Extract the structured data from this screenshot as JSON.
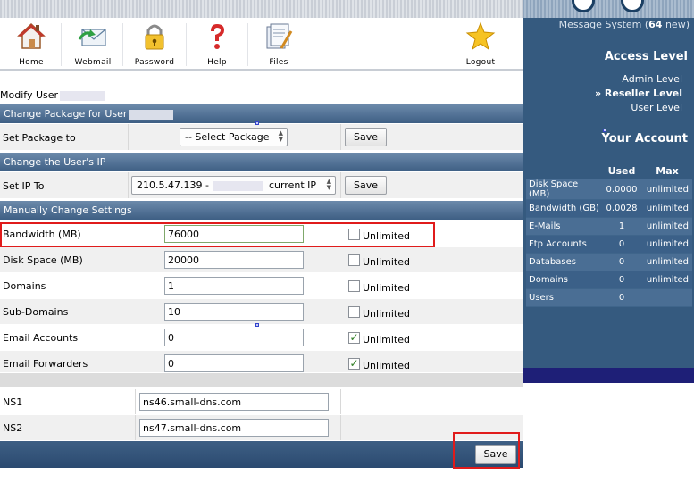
{
  "toolbar": {
    "items": [
      {
        "label": "Home",
        "icon": "home-icon"
      },
      {
        "label": "Webmail",
        "icon": "webmail-icon"
      },
      {
        "label": "Password",
        "icon": "lock-icon"
      },
      {
        "label": "Help",
        "icon": "question-icon"
      },
      {
        "label": "Files",
        "icon": "files-icon"
      },
      {
        "label": "Logout",
        "icon": "star-icon"
      }
    ]
  },
  "right_panel": {
    "message_prefix": "Message System (",
    "message_count": "64",
    "message_suffix": " new)",
    "access_level_title": "Access Level",
    "levels": [
      "Admin Level",
      "» Reseller Level",
      "User Level"
    ],
    "selected_level": 1,
    "account_title": "Your Account",
    "columns": [
      "",
      "Used",
      "Max"
    ],
    "stats": [
      [
        "Disk Space (MB)",
        "0.0000",
        "unlimited"
      ],
      [
        "Bandwidth (GB)",
        "0.0028",
        "unlimited"
      ],
      [
        "E-Mails",
        "1",
        "unlimited"
      ],
      [
        "Ftp Accounts",
        "0",
        "unlimited"
      ],
      [
        "Databases",
        "0",
        "unlimited"
      ],
      [
        "Domains",
        "0",
        "unlimited"
      ],
      [
        "Users",
        "0",
        ""
      ]
    ]
  },
  "main": {
    "modify_user_label": "Modify User",
    "change_package_header": "Change Package for User",
    "set_package_label": "Set Package to",
    "package_select_value": "-- Select Package",
    "save_label": "Save",
    "change_ip_header": "Change the User's IP",
    "set_ip_label": "Set IP To",
    "ip_select_prefix": "210.5.47.139 -",
    "ip_select_suffix": "current IP",
    "manual_header": "Manually Change Settings",
    "unlimited_label": "Unlimited",
    "settings": [
      {
        "label": "Bandwidth (MB)",
        "value": "76000",
        "unlimited": false
      },
      {
        "label": "Disk Space (MB)",
        "value": "20000",
        "unlimited": false
      },
      {
        "label": "Domains",
        "value": "1",
        "unlimited": false
      },
      {
        "label": "Sub-Domains",
        "value": "10",
        "unlimited": false
      },
      {
        "label": "Email Accounts",
        "value": "0",
        "unlimited": true
      },
      {
        "label": "Email Forwarders",
        "value": "0",
        "unlimited": true
      }
    ],
    "ns": [
      {
        "label": "NS1",
        "value": "ns46.small-dns.com"
      },
      {
        "label": "NS2",
        "value": "ns47.small-dns.com"
      }
    ],
    "footer_save_label": "Save"
  },
  "colors": {
    "accent_blue": "#355a7f",
    "highlight_red": "#e01b1b"
  }
}
